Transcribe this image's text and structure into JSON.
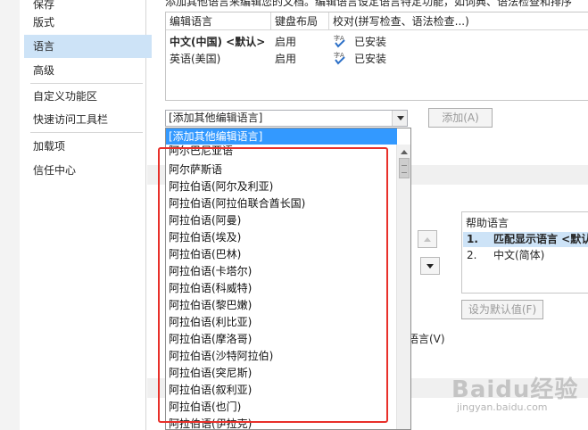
{
  "nav": {
    "items": [
      {
        "label": "保存",
        "selected": false
      },
      {
        "label": "版式",
        "selected": false
      },
      {
        "label": "语言",
        "selected": true
      },
      {
        "label": "高级",
        "selected": false
      },
      {
        "label": "自定义功能区",
        "selected": false
      },
      {
        "label": "快速访问工具栏",
        "selected": false
      },
      {
        "label": "加载项",
        "selected": false
      },
      {
        "label": "信任中心",
        "selected": false
      }
    ]
  },
  "main": {
    "description": "添加其他语言来编辑您的文档。编辑语言设定语言特定功能，如词典、语法检查和排序",
    "table": {
      "headers": [
        "编辑语言",
        "键盘布局",
        "校对(拼写检查、语法检查...)"
      ],
      "rows": [
        {
          "language": "中文(中国) <默认>",
          "keyboard": "启用",
          "proofing": "已安装"
        },
        {
          "language": "英语(美国)",
          "keyboard": "启用",
          "proofing": "已安装"
        }
      ]
    },
    "add_language_combo": "[添加其他编辑语言]",
    "add_button": "添加(A)",
    "help_language": {
      "header": "帮助语言",
      "items": [
        {
          "num": "1.",
          "label": "匹配显示语言 <默认>",
          "selected": true
        },
        {
          "num": "2.",
          "label": "中文(简体)",
          "selected": false
        }
      ]
    },
    "set_default_button": "设为默认值(F)",
    "partial_language_text": "语言(V)"
  },
  "dropdown": {
    "selected": "[添加其他编辑语言]",
    "items": [
      "阿尔巴尼亚语",
      "阿尔萨斯语",
      "阿拉伯语(阿尔及利亚)",
      "阿拉伯语(阿拉伯联合酋长国)",
      "阿拉伯语(阿曼)",
      "阿拉伯语(埃及)",
      "阿拉伯语(巴林)",
      "阿拉伯语(卡塔尔)",
      "阿拉伯语(科威特)",
      "阿拉伯语(黎巴嫩)",
      "阿拉伯语(利比亚)",
      "阿拉伯语(摩洛哥)",
      "阿拉伯语(沙特阿拉伯)",
      "阿拉伯语(突尼斯)",
      "阿拉伯语(叙利亚)",
      "阿拉伯语(也门)",
      "阿拉伯语(伊拉克)"
    ]
  },
  "watermark": {
    "main": "Baidu经验",
    "sub": "jingyan.baidu.com"
  },
  "colors": {
    "selection": "#cde3f7",
    "dropdown_highlight": "#3399ff",
    "annotation": "#e8302a"
  }
}
